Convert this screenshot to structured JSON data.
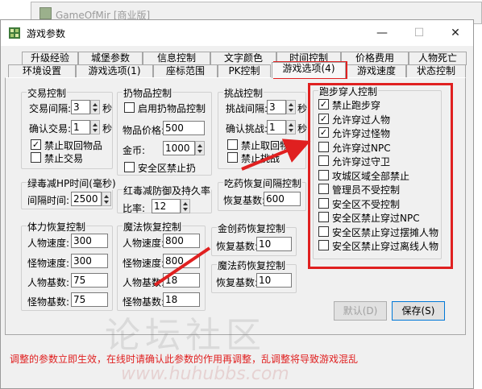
{
  "background_window": {
    "title": "GameOfMir [商业版]"
  },
  "dialog": {
    "title": "游戏参数",
    "minimize": "—",
    "maximize": "☐",
    "close": "✕"
  },
  "tabs_row1": [
    "升级经验",
    "城堡参数",
    "信息控制",
    "文字颜色",
    "时间控制",
    "价格费用",
    "人物死亡"
  ],
  "tabs_row2": [
    "环境设置",
    "游戏选项(1)",
    "座标范围",
    "PK控制",
    "游戏选项(4)",
    "游戏速度",
    "状态控制"
  ],
  "active_tab": "游戏选项(4)",
  "trade": {
    "title": "交易控制",
    "interval_label": "交易间隔:",
    "interval_value": "3",
    "interval_unit": "秒",
    "confirm_label": "确认交易:",
    "confirm_value": "1",
    "confirm_unit": "秒",
    "no_pickup_label": "禁止取回物品",
    "no_pickup_checked": true,
    "no_trade_label": "禁止交易",
    "no_trade_checked": false
  },
  "drop": {
    "title": "扔物品控制",
    "enable_label": "启用扔物品控制",
    "enable_checked": false,
    "price_label": "物品价格:",
    "price_value": "500",
    "gold_label": "金币:",
    "gold_value": "1000",
    "safezone_label": "安全区禁止扔",
    "safezone_checked": false
  },
  "challenge": {
    "title": "挑战控制",
    "interval_label": "挑战间隔:",
    "interval_value": "3",
    "interval_unit": "秒",
    "confirm_label": "确认挑战:",
    "confirm_value": "1",
    "confirm_unit": "秒",
    "no_pickup_label": "禁止取回物品",
    "no_pickup_checked": false,
    "no_challenge_label": "禁止挑战",
    "no_challenge_checked": false
  },
  "green_poison": {
    "title": "绿毒减HP时间(毫秒)",
    "interval_label": "间隔时间:",
    "interval_value": "2500"
  },
  "red_poison": {
    "title": "红毒减防御及持久率",
    "ratio_label": "比率:",
    "ratio_value": "12"
  },
  "potion_interval": {
    "title": "吃药恢复间隔控制",
    "base_label": "恢复基数:",
    "base_value": "600"
  },
  "hp_recovery": {
    "title": "体力恢复控制",
    "rows": [
      {
        "label": "人物速度:",
        "value": "300"
      },
      {
        "label": "怪物速度:",
        "value": "300"
      },
      {
        "label": "人物基数:",
        "value": "75"
      },
      {
        "label": "怪物基数:",
        "value": "75"
      }
    ]
  },
  "mp_recovery": {
    "title": "魔法恢复控制",
    "rows": [
      {
        "label": "人物速度:",
        "value": "800"
      },
      {
        "label": "怪物速度:",
        "value": "800"
      },
      {
        "label": "人物基数:",
        "value": "18"
      },
      {
        "label": "怪物基数:",
        "value": "18"
      }
    ]
  },
  "wound_potion": {
    "title": "金创药恢复控制",
    "base_label": "恢复基数:",
    "base_value": "10"
  },
  "magic_potion": {
    "title": "魔法药恢复控制",
    "base_label": "恢复基数:",
    "base_value": "10"
  },
  "run_through": {
    "title": "跑步穿人控制",
    "items": [
      {
        "label": "禁止跑步穿",
        "checked": true
      },
      {
        "label": "允许穿过人物",
        "checked": true
      },
      {
        "label": "允许穿过怪物",
        "checked": true
      },
      {
        "label": "允许穿过NPC",
        "checked": false
      },
      {
        "label": "允许穿过守卫",
        "checked": false
      },
      {
        "label": "攻城区域全部禁止",
        "checked": false
      },
      {
        "label": "管理员不受控制",
        "checked": false
      },
      {
        "label": "安全区不受控制",
        "checked": false
      },
      {
        "label": "安全区禁止穿过NPC",
        "checked": false
      },
      {
        "label": "安全区禁止穿过摆摊人物",
        "checked": false
      },
      {
        "label": "安全区禁止穿过离线人物",
        "checked": false
      }
    ]
  },
  "buttons": {
    "default": "默认(D)",
    "save": "保存(S)"
  },
  "status_note": "调整的参数立即生效，在线时请确认此参数的作用再调整，乱调整将导致游戏混乱",
  "watermark": {
    "text": "论坛社区",
    "url": "www.huhubbs.com"
  },
  "colors": {
    "highlight": "#e02020",
    "focus_border": "#0078d7"
  }
}
